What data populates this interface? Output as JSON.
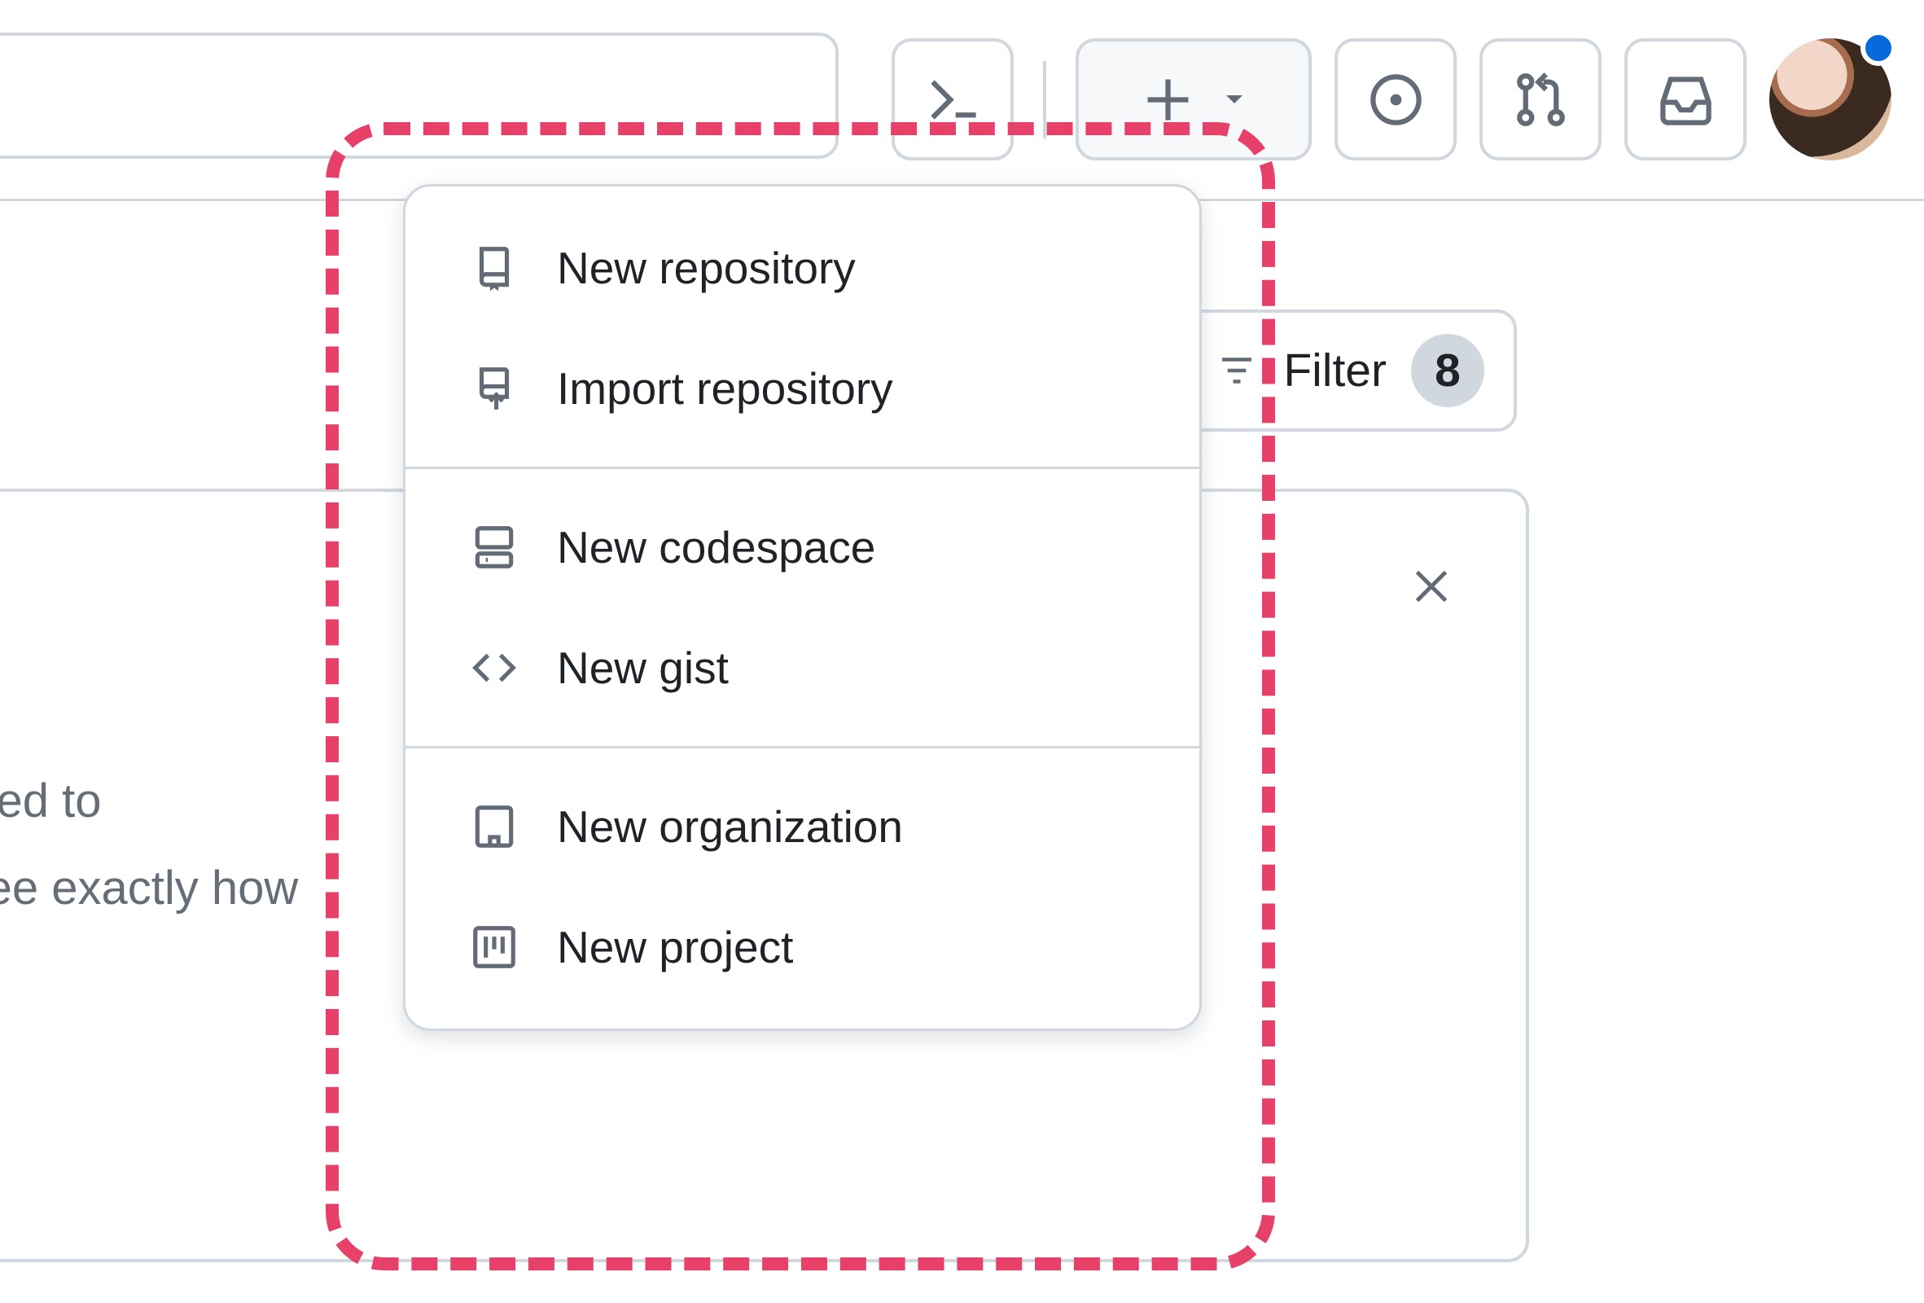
{
  "header": {
    "icons": {
      "command_palette": "command-palette-icon",
      "create": "plus-icon",
      "issues": "issue-opened-icon",
      "pull_requests": "git-pull-request-icon",
      "inbox": "inbox-icon"
    },
    "has_notification": true
  },
  "filter": {
    "label": "Filter",
    "count": "8"
  },
  "card": {
    "body_line1": "d with the For you feed to",
    "body_line2": "iltering so you can see exactly how"
  },
  "create_menu": {
    "groups": [
      [
        {
          "icon": "repo-icon",
          "label": "New repository"
        },
        {
          "icon": "repo-push-icon",
          "label": "Import repository"
        }
      ],
      [
        {
          "icon": "codespaces-icon",
          "label": "New codespace"
        },
        {
          "icon": "code-icon",
          "label": "New gist"
        }
      ],
      [
        {
          "icon": "organization-icon",
          "label": "New organization"
        },
        {
          "icon": "project-icon",
          "label": "New project"
        }
      ]
    ]
  },
  "colors": {
    "highlight": "#e7416a",
    "link_blue": "#0969da",
    "border": "#d0d7de"
  }
}
